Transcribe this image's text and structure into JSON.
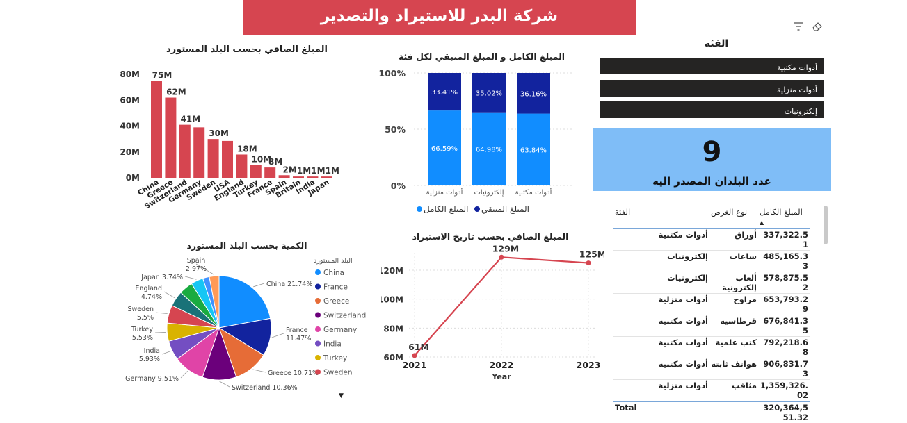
{
  "banner": {
    "title": "شركة البدر للاستيراد والتصدير"
  },
  "toolbar": {
    "filter_icon": "filter-icon",
    "eraser_icon": "eraser-icon"
  },
  "slicer": {
    "title": "الفئة",
    "items": [
      "أدوات مكتبية",
      "أدوات منزلية",
      "إلكترونيات"
    ]
  },
  "kpi": {
    "value": "9",
    "label": "عدد البلدان المصدر اليه"
  },
  "table": {
    "headers": {
      "category": "الفئة",
      "purpose": "نوع الغرض",
      "amount": "المبلغ الكامل"
    },
    "rows": [
      {
        "category": "أدوات مكتبية",
        "purpose": "أوراق",
        "amount": "337,322.51"
      },
      {
        "category": "إلكترونيات",
        "purpose": "ساعات",
        "amount": "485,165.33"
      },
      {
        "category": "إلكترونيات",
        "purpose": "ألعاب إلكترونية",
        "amount": "578,875.52"
      },
      {
        "category": "أدوات منزلية",
        "purpose": "مراوح",
        "amount": "653,793.29"
      },
      {
        "category": "أدوات مكتبية",
        "purpose": "قرطاسية",
        "amount": "676,841.35"
      },
      {
        "category": "أدوات مكتبية",
        "purpose": "كتب علمية",
        "amount": "792,218.68"
      },
      {
        "category": "أدوات مكتبية",
        "purpose": "هواتف ثابتة",
        "amount": "906,831.73"
      },
      {
        "category": "أدوات منزلية",
        "purpose": "مثاقب",
        "amount": "1,359,326.02"
      }
    ],
    "total": {
      "label": "Total",
      "amount": "320,364,551.32"
    }
  },
  "chart_data": [
    {
      "id": "bar-net-by-country",
      "type": "bar",
      "title": "المبلغ الصافي بحسب البلد المستورد",
      "categories": [
        "China",
        "Greece",
        "Switzerland",
        "Germany",
        "Sweden",
        "USA",
        "England",
        "Turkey",
        "France",
        "Spain",
        "Britain",
        "India",
        "Japan"
      ],
      "values": [
        75,
        62,
        41,
        39,
        30,
        28.5,
        18,
        10,
        8,
        2,
        1,
        1,
        1
      ],
      "data_labels": [
        "75M",
        "62M",
        "41M",
        "",
        "30M",
        "",
        "18M",
        "10M",
        "8M",
        "2M",
        "1M",
        "1M",
        "1M"
      ],
      "ytick_labels": [
        "0M",
        "20M",
        "40M",
        "60M",
        "80M"
      ],
      "ylim": [
        0,
        80
      ],
      "color": "#d64550"
    },
    {
      "id": "stacked-by-category",
      "type": "bar",
      "stacked": "100%",
      "title": "المبلغ الكامل و المبلغ المتبقي لكل فئة",
      "categories": [
        "أدوات منزلية",
        "إلكترونيات",
        "أدوات مكتبية"
      ],
      "series": [
        {
          "name": "المبلغ الكامل",
          "values": [
            66.59,
            64.98,
            63.84
          ],
          "labels": [
            "66.59%",
            "64.98%",
            "63.84%"
          ],
          "color": "#118dff"
        },
        {
          "name": "المبلغ المتبقي",
          "values": [
            33.41,
            35.02,
            36.16
          ],
          "labels": [
            "33.41%",
            "35.02%",
            "36.16%"
          ],
          "color": "#12239e"
        }
      ],
      "ytick_labels": [
        "0%",
        "50%",
        "100%"
      ],
      "ylim": [
        0,
        100
      ]
    },
    {
      "id": "pie-qty-by-country",
      "type": "pie",
      "title": "الكمية بحسب البلد المستورد",
      "legend_title": "البلد المستورد",
      "legend": [
        "China",
        "France",
        "Greece",
        "Switzerland",
        "Germany",
        "India",
        "Turkey",
        "Sweden"
      ],
      "slices": [
        {
          "name": "China",
          "value": 21.74,
          "label": "China 21.74%",
          "color": "#118dff"
        },
        {
          "name": "France",
          "value": 11.47,
          "label": "France 11.47%",
          "color": "#12239e"
        },
        {
          "name": "Greece",
          "value": 10.71,
          "label": "Greece 10.71%",
          "color": "#e66c37"
        },
        {
          "name": "Switzerland",
          "value": 10.36,
          "label": "Switzerland 10.36%",
          "color": "#6b007b"
        },
        {
          "name": "Germany",
          "value": 9.51,
          "label": "Germany 9.51%",
          "color": "#e044a7"
        },
        {
          "name": "India",
          "value": 5.93,
          "label": "India 5.93%",
          "color": "#744ec2"
        },
        {
          "name": "Turkey",
          "value": 5.53,
          "label": "Turkey 5.53%",
          "color": "#d9b300"
        },
        {
          "name": "Sweden",
          "value": 5.5,
          "label": "Sweden 5.5%",
          "color": "#d64550"
        },
        {
          "name": "England",
          "value": 4.74,
          "label": "England 4.74%",
          "color": "#197278"
        },
        {
          "name": "USA",
          "value": 4.2,
          "label": "",
          "color": "#1aab40"
        },
        {
          "name": "Japan",
          "value": 3.74,
          "label": "Japan 3.74%",
          "color": "#15c6f4"
        },
        {
          "name": "Britain",
          "value": 2.0,
          "label": "",
          "color": "#4092ff"
        },
        {
          "name": "Spain",
          "value": 2.97,
          "label": "Spain 2.97%",
          "color": "#ff9a57"
        }
      ]
    },
    {
      "id": "line-net-by-year",
      "type": "line",
      "title": "المبلغ الصافي بحسب تاريخ الاستيراد",
      "xlabel": "Year",
      "x": [
        "2021",
        "2022",
        "2023"
      ],
      "values": [
        61,
        129,
        125
      ],
      "data_labels": [
        "61M",
        "129M",
        "125M"
      ],
      "ytick_labels": [
        "60M",
        "80M",
        "100M",
        "120M"
      ],
      "yticks": [
        60,
        80,
        100,
        120
      ],
      "ylim": [
        60,
        132
      ],
      "color": "#d64550"
    }
  ]
}
